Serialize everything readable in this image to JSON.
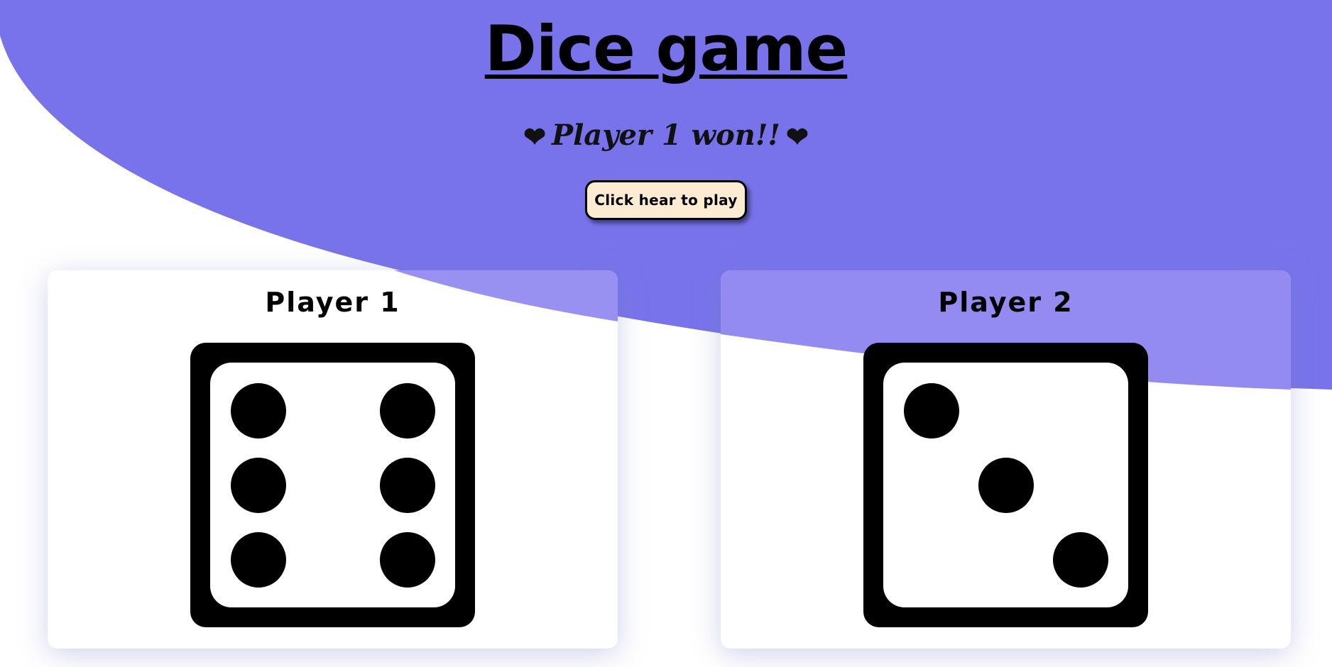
{
  "header": {
    "title": "Dice game",
    "result_text": "Player 1 won!!",
    "heart_glyph": "❤"
  },
  "controls": {
    "play_label": "Click hear to play"
  },
  "players": [
    {
      "label": "Player 1",
      "die_value": 6
    },
    {
      "label": "Player 2",
      "die_value": 3
    }
  ],
  "colors": {
    "wave": "#7873ea",
    "wave_light": "#938bf0",
    "button_bg": "#fdebd2",
    "die": "#000000",
    "card_bg": "#ffffff"
  }
}
